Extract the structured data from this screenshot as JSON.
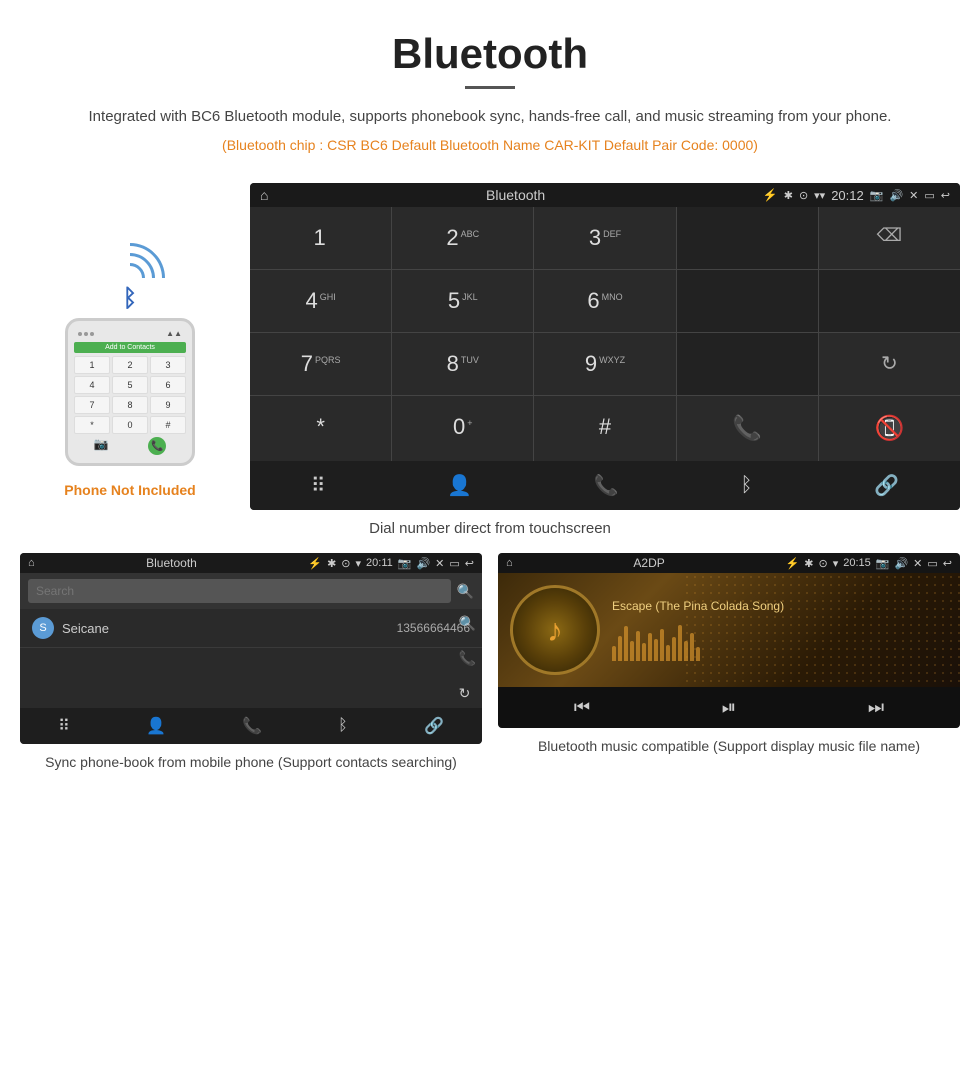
{
  "header": {
    "title": "Bluetooth",
    "description": "Integrated with BC6 Bluetooth module, supports phonebook sync, hands-free call, and music streaming from your phone.",
    "specs": "(Bluetooth chip : CSR BC6    Default Bluetooth Name CAR-KIT    Default Pair Code: 0000)"
  },
  "phone_label": "Phone Not Included",
  "phone_mockup": {
    "add_to_contacts": "Add to Contacts",
    "keys": [
      "1",
      "2",
      "3",
      "4",
      "5",
      "6",
      "7",
      "8",
      "9",
      "*",
      "0",
      "#"
    ]
  },
  "car_screen": {
    "status_bar": {
      "title": "Bluetooth",
      "time": "20:12"
    },
    "dialpad": {
      "keys": [
        {
          "main": "1",
          "sub": ""
        },
        {
          "main": "2",
          "sub": "ABC"
        },
        {
          "main": "3",
          "sub": "DEF"
        },
        {
          "main": "",
          "sub": ""
        },
        {
          "main": "⌫",
          "sub": ""
        },
        {
          "main": "4",
          "sub": "GHI"
        },
        {
          "main": "5",
          "sub": "JKL"
        },
        {
          "main": "6",
          "sub": "MNO"
        },
        {
          "main": "",
          "sub": ""
        },
        {
          "main": "",
          "sub": ""
        },
        {
          "main": "7",
          "sub": "PQRS"
        },
        {
          "main": "8",
          "sub": "TUV"
        },
        {
          "main": "9",
          "sub": "WXYZ"
        },
        {
          "main": "",
          "sub": ""
        },
        {
          "main": "↺",
          "sub": ""
        },
        {
          "main": "*",
          "sub": ""
        },
        {
          "main": "0",
          "sub": "+"
        },
        {
          "main": "#",
          "sub": ""
        },
        {
          "main": "📞",
          "sub": ""
        },
        {
          "main": "📞",
          "sub": ""
        }
      ]
    },
    "caption": "Dial number direct from touchscreen"
  },
  "contacts_screen": {
    "status_bar": {
      "title": "Bluetooth",
      "time": "20:11"
    },
    "search_placeholder": "Search",
    "contacts": [
      {
        "initial": "S",
        "name": "Seicane",
        "number": "13566664466"
      }
    ],
    "caption": "Sync phone-book from mobile phone\n(Support contacts searching)"
  },
  "music_screen": {
    "status_bar": {
      "title": "A2DP",
      "time": "20:15"
    },
    "song_title": "Escape (The Pina Colada Song)",
    "caption": "Bluetooth music compatible\n(Support display music file name)"
  }
}
